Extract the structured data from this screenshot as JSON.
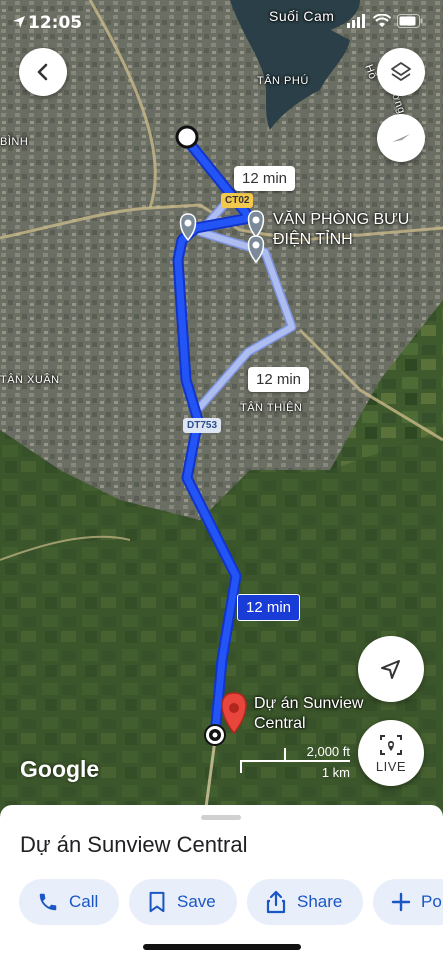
{
  "status_bar": {
    "time": "12:05"
  },
  "map": {
    "labels": {
      "suoi_cam": "Suối Cam",
      "tan_phu": "TÂN PHÚ",
      "binh": "BÌNH",
      "tan_xuan": "TÂN XUÂN",
      "tan_thien": "TÂN THIỆN",
      "ho_phuong": "Hồ",
      "huong": "Hương"
    },
    "road_shields": {
      "ct02": "CT02",
      "dt753": "DT753"
    },
    "poi": {
      "line1": "VĂN PHÒNG BƯU",
      "line2": "ĐIỆN TỈNH"
    },
    "route_times": {
      "alt_top": "12 min",
      "alt_mid": "12 min",
      "main": "12 min"
    },
    "destination": {
      "line1": "Dự án Sunview",
      "line2": "Central"
    },
    "attribution": "Google",
    "scale": {
      "imperial": "2,000 ft",
      "metric": "1 km"
    },
    "live_label": "LIVE",
    "colors": {
      "route_primary": "#2354f5",
      "route_alt": "#a9b9ef",
      "pin": "#e8453c"
    }
  },
  "sheet": {
    "title": "Dự án Sunview Central",
    "actions": [
      {
        "label": "Call",
        "icon": "phone-icon"
      },
      {
        "label": "Save",
        "icon": "bookmark-icon"
      },
      {
        "label": "Share",
        "icon": "share-icon"
      },
      {
        "label": "Po",
        "icon": "plus-icon"
      }
    ]
  }
}
